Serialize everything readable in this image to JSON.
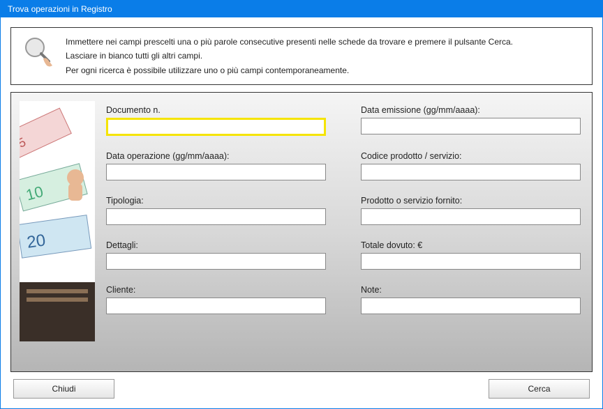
{
  "window": {
    "title": "Trova operazioni in Registro"
  },
  "info": {
    "line1": "Immettere nei campi prescelti una o più parole consecutive presenti nelle schede da trovare e premere il pulsante Cerca.",
    "line2": "Lasciare in bianco tutti gli altri campi.",
    "line3": "Per ogni ricerca è possibile utilizzare uno o più campi contemporaneamente."
  },
  "fields": {
    "documento_n": {
      "label": "Documento n.",
      "value": ""
    },
    "data_emissione": {
      "label": "Data emissione (gg/mm/aaaa):",
      "value": ""
    },
    "data_operazione": {
      "label": "Data operazione (gg/mm/aaaa):",
      "value": ""
    },
    "codice_prodotto": {
      "label": "Codice prodotto / servizio:",
      "value": ""
    },
    "tipologia": {
      "label": "Tipologia:",
      "value": ""
    },
    "prodotto_servizio": {
      "label": "Prodotto o servizio fornito:",
      "value": ""
    },
    "dettagli": {
      "label": "Dettagli:",
      "value": ""
    },
    "totale_dovuto": {
      "label": "Totale dovuto: €",
      "value": ""
    },
    "cliente": {
      "label": "Cliente:",
      "value": ""
    },
    "note": {
      "label": "Note:",
      "value": ""
    }
  },
  "buttons": {
    "close": "Chiudi",
    "search": "Cerca"
  }
}
